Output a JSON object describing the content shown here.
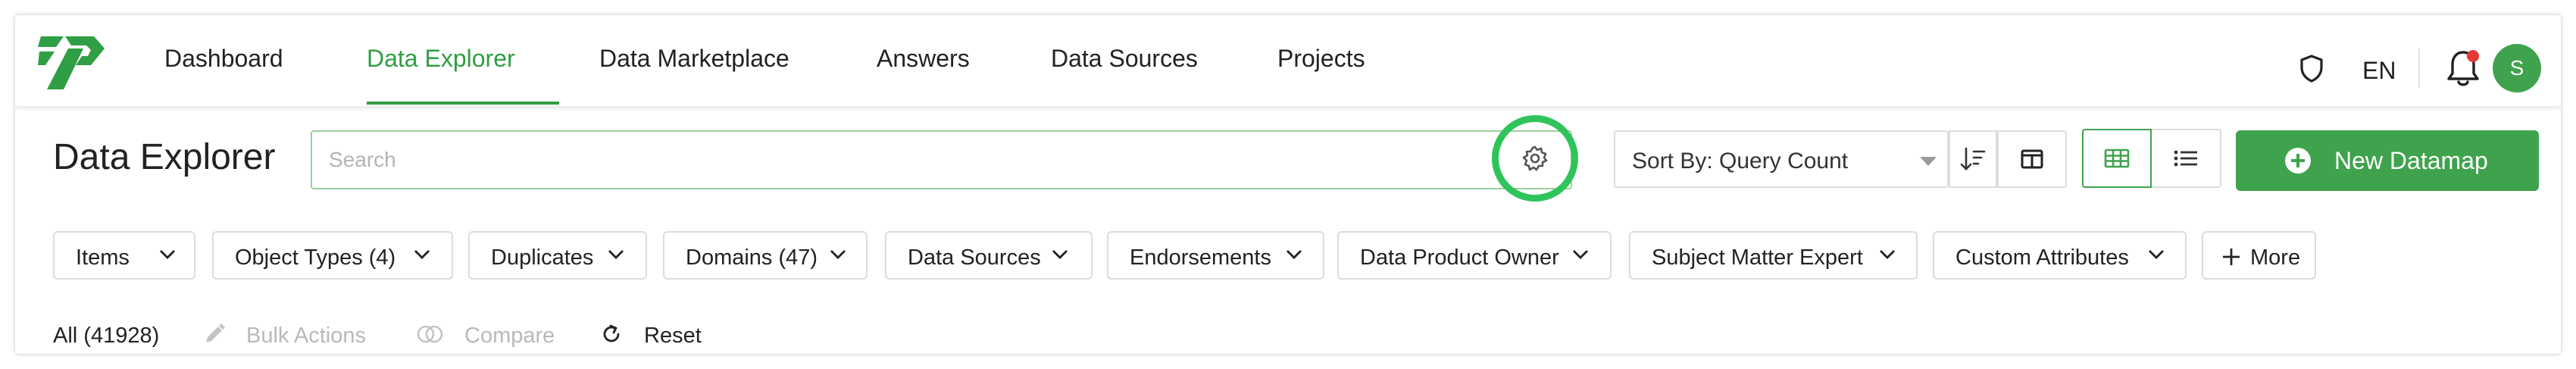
{
  "nav": {
    "items": [
      {
        "label": "Dashboard",
        "active": false
      },
      {
        "label": "Data Explorer",
        "active": true
      },
      {
        "label": "Data Marketplace",
        "active": false
      },
      {
        "label": "Answers",
        "active": false
      },
      {
        "label": "Data Sources",
        "active": false
      },
      {
        "label": "Projects",
        "active": false
      }
    ],
    "language": "EN",
    "avatar_initial": "S",
    "notification_dot": true,
    "icons": [
      "logo",
      "shield-icon",
      "bell-icon"
    ]
  },
  "header": {
    "title": "Data Explorer",
    "search_placeholder": "Search",
    "search_value": "",
    "sort_label": "Sort By: Query Count",
    "view_mode": "grid",
    "new_button_label": "New Datamap"
  },
  "filters": [
    {
      "label": "Items"
    },
    {
      "label": "Object Types (4)"
    },
    {
      "label": "Duplicates"
    },
    {
      "label": "Domains (47)"
    },
    {
      "label": "Data Sources"
    },
    {
      "label": "Endorsements"
    },
    {
      "label": "Data Product Owner"
    },
    {
      "label": "Subject Matter Expert"
    },
    {
      "label": "Custom Attributes"
    }
  ],
  "more_label": "More",
  "actions": {
    "all_count": "All (41928)",
    "bulk_actions": "Bulk Actions",
    "compare": "Compare",
    "reset": "Reset"
  },
  "colors": {
    "accent": "#3fa34d",
    "active_nav": "#2f9e44",
    "highlight_ring": "#2ec45a",
    "notification": "#e53935",
    "disabled_text": "#b9b9b9"
  }
}
